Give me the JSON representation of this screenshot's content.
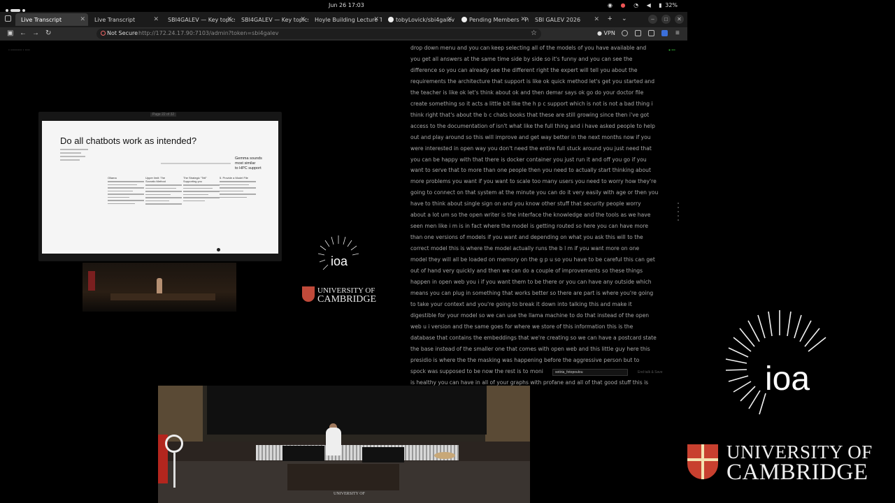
{
  "os": {
    "clock": "Jun 26  17:03",
    "battery": "32%"
  },
  "tabs": [
    {
      "label": "Live Transcript",
      "active": true
    },
    {
      "label": "Live Transcript",
      "active": false
    },
    {
      "label": "SBI4GALEV — Key topics",
      "active": false
    },
    {
      "label": "SBI4GALEV — Key topics",
      "active": false
    },
    {
      "label": "Hoyle Building Lecture T",
      "active": false
    },
    {
      "label": "tobyLovick/sbi4galev",
      "active": false
    },
    {
      "label": "Pending Members · Pr",
      "active": false
    },
    {
      "label": "SBI GALEV 2026",
      "active": false
    }
  ],
  "address_bar": {
    "security": "Not Secure",
    "url": "http://172.24.17.90:7103/admin?token=sbi4galev"
  },
  "toolbar": {
    "vpn_label": "VPN"
  },
  "slide": {
    "counter": "Page 22 of 32",
    "title": "Do all chatbots work as intended?",
    "callout": "Gemma sounds\nmost similar\nto HPC support",
    "columns": [
      {
        "label": "Ollama"
      },
      {
        "label": "Upper limit: The\nSocratic Method"
      },
      {
        "label": "The Strategic \"Tell\"\nSupporting you"
      },
      {
        "label": "5. Provide a Model File"
      }
    ]
  },
  "branding": {
    "ioa": "ioa",
    "cam_line1": "UNIVERSITY OF",
    "cam_line2": "CAMBRIDGE"
  },
  "transcript": {
    "lines": [
      "drop down menu and you can keep selecting all of the models of you have available and",
      "you get all answers at the same time side by side so it's funny and you can see the",
      "difference so you can already see the different right the expert will tell you about the",
      "requirements the architecture that support is like ok quick method let's get you started and",
      "the teacher is like ok let's think about ok and then demar says ok go do your doctor file",
      "create something so it acts a little bit like the h p c support which is not is not a bad thing i",
      "think right that's about the b c chats books that these are still growing since then i've got",
      "access to the documentation of isn't what like the full thing and i have asked people to help",
      "out and play around so this will improve and get way better in the next months now if you",
      "were interested in open way you don't need the entire full stuck around you just need that",
      "you can be happy with that there is docker container you just run it and off you go if you",
      "want to serve that to more than one people then you need to actually start thinking about",
      "more problems you want if you want to scale too many users you need to worry how they're",
      "going to connect on that system at the minute you can do it very easily with age or then you",
      "have to think about single sign on and you know other stuff that security people worry",
      "about a lot um so the open writer is the interface the knowledge and the tools as we have",
      "seen men like i m is in fact where the model is getting routed so here you can have more",
      "than one versions of models if you want and depending on what you ask this will to the",
      "correct model this is where the model actually runs the b l m if you want more on one",
      "model they will all be loaded on memory on the g p u so you have to be careful this can get",
      "out of hand very quickly and then we can do a couple of improvements so these things",
      "happen in open web you i if you want them to be there or you can have any outside which",
      "means you can plug in something that works better so there are part is where you're going",
      "to take your context and you're going to break it down into talking this and make it",
      "digestible for your model so we can use the llama machine to do that instead of the open",
      "web u i version and the same goes for where we store of this information this is the",
      "database that contains the embeddings that we're creating so we can have a postcard state",
      "the base instead of the smaller one that comes with open web and this little guy here this",
      "presidio is where the the masking was happening before the aggressive person but to",
      "spock was supposed to be now the rest is to moni",
      "is healthy you can have in all of your graphs with profane and all of that good stuff this is"
    ],
    "name_input_value": "sotiria_fotopoulou",
    "end_talk_label": "End talk & Save"
  },
  "video": {
    "label": "UNIVERSITY OF"
  }
}
